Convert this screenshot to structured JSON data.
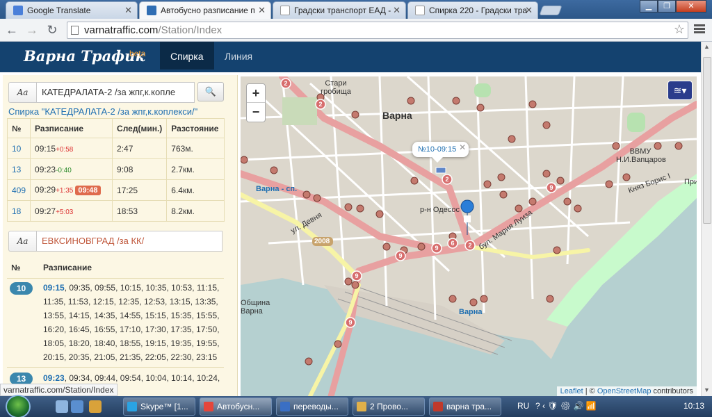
{
  "browser": {
    "tabs": [
      {
        "title": "Google Translate",
        "color": "#4a7fd9"
      },
      {
        "title": "Автобусно разписание п",
        "color": "#2f6db3"
      },
      {
        "title": "Градски транспорт ЕАД -",
        "color": "#dfe4ea"
      },
      {
        "title": "Спирка 220 - Градски тра",
        "color": "#dfe4ea"
      }
    ],
    "url_host": "varnatraffic.com",
    "url_path": "/Station/Index",
    "status_url": "varnatraffic.com/Station/Index"
  },
  "site": {
    "logo": "Варна Трафик",
    "beta": "beta",
    "nav": [
      "Спирка",
      "Линия"
    ]
  },
  "panel": {
    "aa_label": "Aa",
    "search_value": "КАТЕДРАЛАТА-2 /за жпг,к.копле",
    "stop_title": "Спирка \"КАТЕДРАЛАТА-2 /за жпг,к.коплекси/\"",
    "columns": [
      "№",
      "Разписание",
      "След(мин.)",
      "Разстояние"
    ],
    "rows": [
      {
        "line": "10",
        "time": "09:15",
        "delta": "+0:58",
        "delta_type": "plus",
        "late": "",
        "next": "2:47",
        "dist": "763м."
      },
      {
        "line": "13",
        "time": "09:23",
        "delta": "-0:40",
        "delta_type": "minus",
        "late": "",
        "next": "9:08",
        "dist": "2.7км."
      },
      {
        "line": "409",
        "time": "09:29",
        "delta": "+1:35",
        "delta_type": "plus",
        "late": "09:48",
        "next": "17:25",
        "dist": "6.4км."
      },
      {
        "line": "18",
        "time": "09:27",
        "delta": "+5:03",
        "delta_type": "plus",
        "late": "",
        "next": "18:53",
        "dist": "8.2км."
      }
    ],
    "direction2_value": "ЕВКСИНОВГРАД /за КК/",
    "sched_columns": [
      "№",
      "Разписание"
    ],
    "sched_blocks": [
      {
        "line": "10",
        "first": "09:15",
        "rest": ", 09:35, 09:55, 10:15, 10:35, 10:53, 11:15, 11:35, 11:53, 12:15, 12:35, 12:53, 13:15, 13:35, 13:55, 14:15, 14:35, 14:55, 15:15, 15:35, 15:55, 16:20, 16:45, 16:55, 17:10, 17:30, 17:35, 17:50, 18:05, 18:20, 18:40, 18:55, 19:15, 19:35, 19:55, 20:15, 20:35, 21:05, 21:35, 22:05, 22:30, 23:15"
      },
      {
        "line": "13",
        "first": "09:23",
        "rest": ", 09:34, 09:44, 09:54, 10:04, 10:14, 10:24,"
      }
    ]
  },
  "map": {
    "zoom_in": "+",
    "zoom_out": "−",
    "popup": "№10-09:15",
    "labels": [
      "Варна",
      "Стари гробища",
      "ВВМУ Н.И.Вапцаров",
      "Варна - сп.",
      "р-н Одесос",
      "ул. Девня",
      "бул. Мария Луиза",
      "2008",
      "Община Варна",
      "Варна",
      "Княз Борис I",
      "При"
    ],
    "attribution": {
      "leaflet": "Leaflet",
      "sep": " | © ",
      "osm": "OpenStreetMap",
      "suffix": " contributors"
    }
  },
  "taskbar": {
    "tasks": [
      "Skype™ [1...",
      "Автобусн...",
      "переводы...",
      "2 Прово...",
      "варна тра..."
    ],
    "lang": "RU",
    "time": "10:13"
  }
}
